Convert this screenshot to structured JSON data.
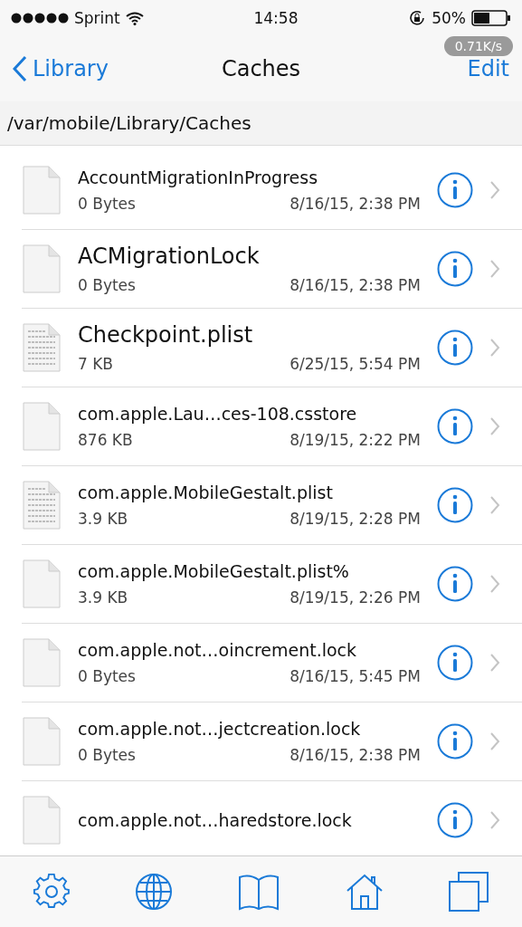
{
  "status_bar": {
    "carrier": "Sprint",
    "time": "14:58",
    "battery": "50%"
  },
  "nav": {
    "back": "Library",
    "title": "Caches",
    "action": "Edit",
    "speed": "0.71K/s"
  },
  "path": "/var/mobile/Library/Caches",
  "files": [
    {
      "kind": "blank",
      "name": "AccountMigrationInProgress",
      "size": "0 Bytes",
      "date": "8/16/15, 2:38 PM"
    },
    {
      "kind": "blank",
      "name": "ACMigrationLock",
      "size": "0 Bytes",
      "date": "8/16/15, 2:38 PM"
    },
    {
      "kind": "text",
      "name": "Checkpoint.plist",
      "size": "7 KB",
      "date": "6/25/15, 5:54 PM"
    },
    {
      "kind": "blank",
      "name": "com.apple.Lau…ces-108.csstore",
      "size": "876 KB",
      "date": "8/19/15, 2:22 PM"
    },
    {
      "kind": "text",
      "name": "com.apple.MobileGestalt.plist",
      "size": "3.9 KB",
      "date": "8/19/15, 2:28 PM"
    },
    {
      "kind": "blank",
      "name": "com.apple.MobileGestalt.plist%",
      "size": "3.9 KB",
      "date": "8/19/15, 2:26 PM"
    },
    {
      "kind": "blank",
      "name": "com.apple.not…oincrement.lock",
      "size": "0 Bytes",
      "date": "8/16/15, 5:45 PM"
    },
    {
      "kind": "blank",
      "name": "com.apple.not…jectcreation.lock",
      "size": "0 Bytes",
      "date": "8/16/15, 2:38 PM"
    },
    {
      "kind": "blank",
      "name": "com.apple.not…haredstore.lock"
    }
  ]
}
